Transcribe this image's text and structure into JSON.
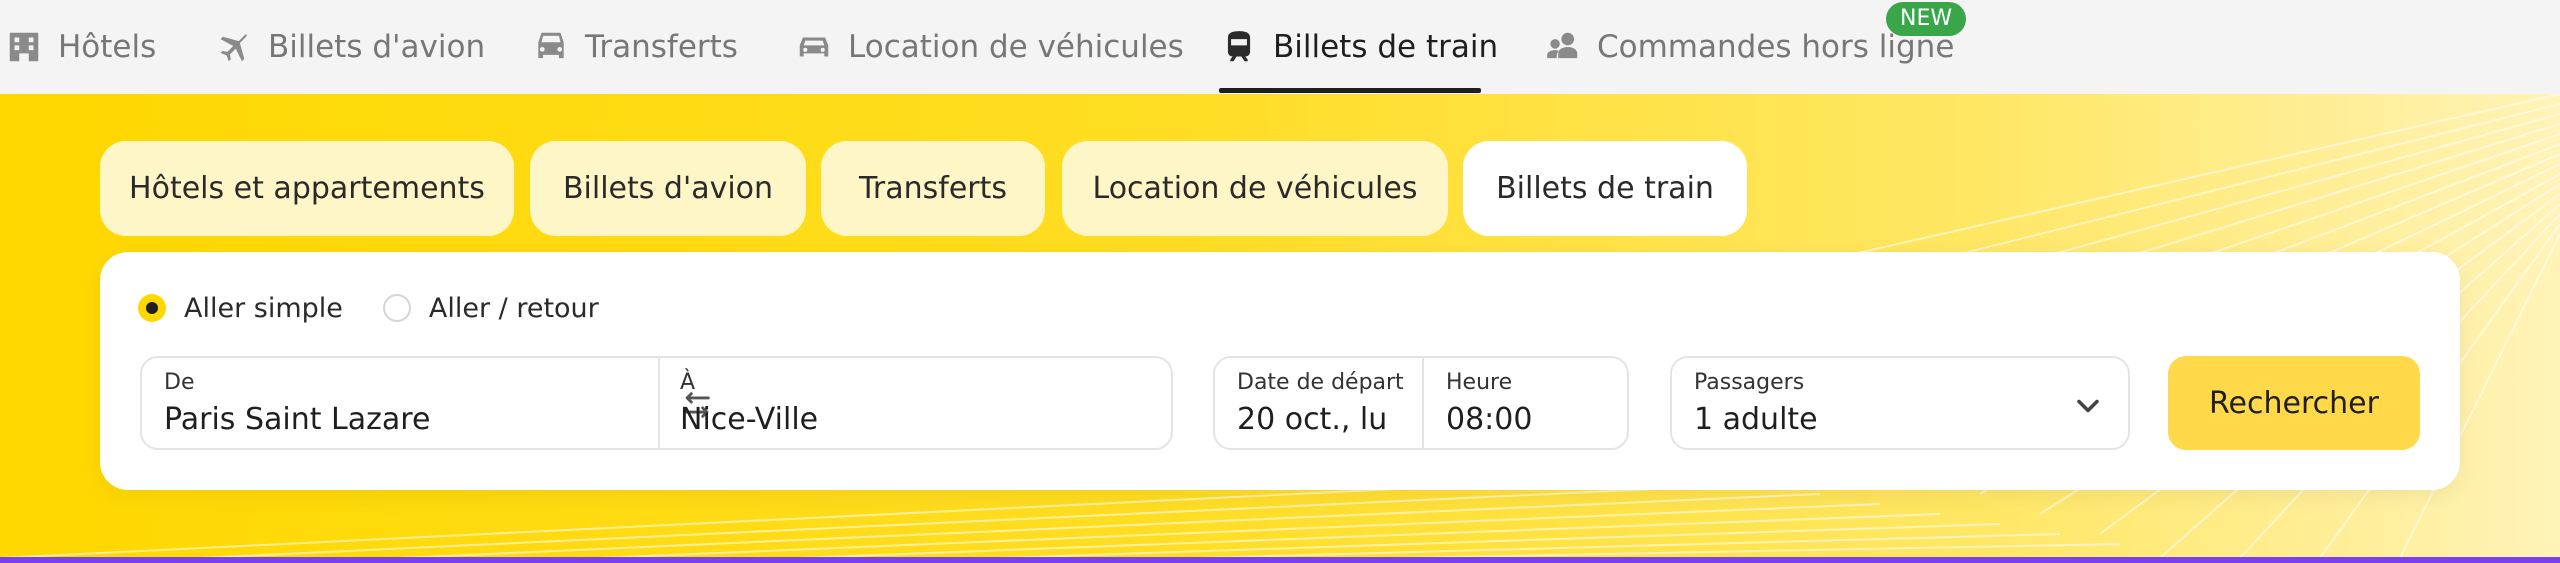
{
  "topnav": {
    "items": [
      {
        "label": "Hôtels",
        "icon": "hotel-icon"
      },
      {
        "label": "Billets d'avion",
        "icon": "airplane-icon"
      },
      {
        "label": "Transferts",
        "icon": "car-front-icon"
      },
      {
        "label": "Location de véhicules",
        "icon": "car-icon"
      },
      {
        "label": "Billets de train",
        "icon": "train-icon",
        "active": true
      },
      {
        "label": "Commandes hors ligne",
        "icon": "support-agent-icon"
      }
    ],
    "badge": "NEW"
  },
  "service_tabs": [
    {
      "label": "Hôtels et appartements"
    },
    {
      "label": "Billets d'avion"
    },
    {
      "label": "Transferts"
    },
    {
      "label": "Location de véhicules"
    },
    {
      "label": "Billets de train",
      "active": true
    }
  ],
  "form": {
    "trip_type": {
      "options": [
        {
          "label": "Aller simple",
          "selected": true
        },
        {
          "label": "Aller / retour",
          "selected": false
        }
      ]
    },
    "from": {
      "label": "De",
      "value": "Paris Saint Lazare"
    },
    "to": {
      "label": "À",
      "value": "Nice-Ville"
    },
    "swap_icon": "swap-arrows-icon",
    "departure_date": {
      "label": "Date de départ",
      "value": "20 oct., lu"
    },
    "time": {
      "label": "Heure",
      "value": "08:00"
    },
    "passengers": {
      "label": "Passagers",
      "value": "1 adulte",
      "icon": "chevron-down-icon"
    },
    "search_label": "Rechercher"
  },
  "colors": {
    "brand_yellow": "#ffd800",
    "button_yellow": "#ffd94a",
    "badge_green": "#3aa64a",
    "accent_purple": "#7b3ff2"
  }
}
